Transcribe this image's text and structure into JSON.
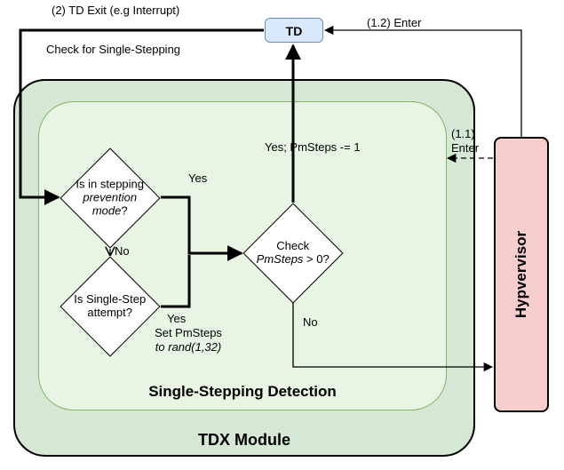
{
  "type": "flowchart",
  "title": "TDX Single-Stepping Detection Flow",
  "nodes": {
    "td": {
      "label": "TD",
      "kind": "process"
    },
    "hypervisor": {
      "label": "Hypvervisor",
      "kind": "process"
    },
    "tdx_module": {
      "label": "TDX Module",
      "kind": "container"
    },
    "ssd": {
      "label": "Single-Stepping Detection",
      "kind": "container"
    },
    "d_prev_mode": {
      "label_line1": "Is in stepping",
      "label_line2": "prevention",
      "label_line3": "mode",
      "suffix": "?",
      "kind": "decision"
    },
    "d_ss_attempt": {
      "label_line1": "Is Single-Step",
      "label_line2": "attempt?",
      "kind": "decision"
    },
    "d_pmsteps": {
      "label_line1": "Check",
      "label_line2": "PmSteps",
      "label_line3": "> 0?",
      "kind": "decision"
    }
  },
  "edges": {
    "e_1_1": {
      "label": "(1.1)",
      "label2": "Enter"
    },
    "e_1_2": {
      "label": "(1.2) Enter"
    },
    "e_2_exit": {
      "label": "(2) TD Exit (e.g Interrupt)"
    },
    "e_check_ss": {
      "label": "Check for Single-Stepping"
    },
    "e_prev_yes": {
      "label": "Yes"
    },
    "e_prev_no": {
      "label": "No"
    },
    "e_attempt_yes": {
      "label": "Yes",
      "sub1": "Set PmSteps",
      "sub2": "to rand(1,32)"
    },
    "e_pmsteps_yes": {
      "label": "Yes; PmSteps -= 1"
    },
    "e_pmsteps_no": {
      "label": "No"
    }
  },
  "chart_data": {
    "type": "flowchart",
    "containers": [
      {
        "id": "tdx_module",
        "label": "TDX Module",
        "contains": [
          "ssd"
        ]
      },
      {
        "id": "ssd",
        "label": "Single-Stepping Detection",
        "contains": [
          "d_prev_mode",
          "d_ss_attempt",
          "d_pmsteps"
        ]
      }
    ],
    "nodes": [
      {
        "id": "td",
        "label": "TD",
        "shape": "rounded-rect"
      },
      {
        "id": "hypervisor",
        "label": "Hypvervisor",
        "shape": "rounded-rect"
      },
      {
        "id": "d_prev_mode",
        "label": "Is in stepping prevention mode?",
        "shape": "diamond"
      },
      {
        "id": "d_ss_attempt",
        "label": "Is Single-Step attempt?",
        "shape": "diamond"
      },
      {
        "id": "d_pmsteps",
        "label": "Check PmSteps > 0?",
        "shape": "diamond"
      }
    ],
    "edges": [
      {
        "from": "hypervisor",
        "to": "tdx_module",
        "label": "(1.1) Enter",
        "style": "dashed"
      },
      {
        "from": "hypervisor",
        "to": "td",
        "label": "(1.2) Enter"
      },
      {
        "from": "td",
        "to": "tdx_module",
        "label": "(2) TD Exit (e.g Interrupt)"
      },
      {
        "from": "tdx_module_entry",
        "to": "d_prev_mode",
        "label": "Check for Single-Stepping"
      },
      {
        "from": "d_prev_mode",
        "to": "d_pmsteps",
        "label": "Yes"
      },
      {
        "from": "d_prev_mode",
        "to": "d_ss_attempt",
        "label": "No"
      },
      {
        "from": "d_ss_attempt",
        "to": "d_pmsteps",
        "label": "Yes — Set PmSteps to rand(1,32)"
      },
      {
        "from": "d_ss_attempt",
        "to": "hypervisor",
        "label": "No",
        "implicit": true
      },
      {
        "from": "d_pmsteps",
        "to": "td",
        "label": "Yes; PmSteps -= 1"
      },
      {
        "from": "d_pmsteps",
        "to": "hypervisor",
        "label": "No"
      }
    ]
  }
}
